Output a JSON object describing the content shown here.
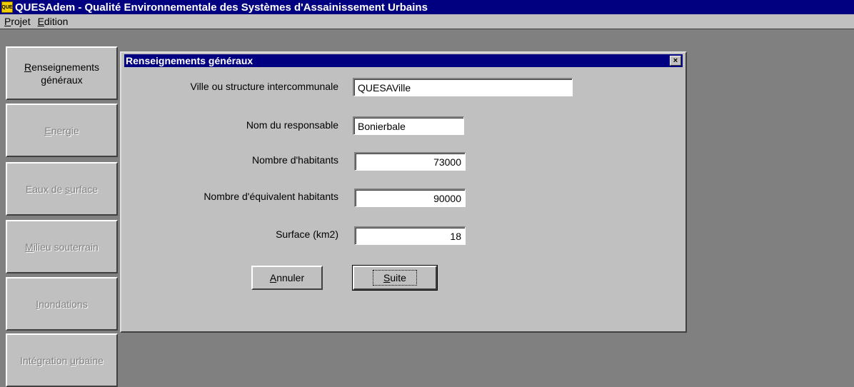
{
  "app": {
    "icon_text": "QUE",
    "title": "QUESAdem - Qualité Environnementale des Systèmes d'Assainissement Urbains"
  },
  "menu": [
    {
      "accel": "P",
      "rest": "rojet"
    },
    {
      "accel": "E",
      "rest": "dition"
    }
  ],
  "sidebar": {
    "items": [
      {
        "line1_accel": "R",
        "line1_rest": "enseignements",
        "line2": "généraux",
        "enabled": true
      },
      {
        "label_pre": "",
        "accel": "E",
        "label_post": "nergie",
        "enabled": false
      },
      {
        "label_pre": "Eaux de ",
        "accel": "s",
        "label_post": "urface",
        "enabled": false
      },
      {
        "label_pre": "",
        "accel": "M",
        "label_post": "ilieu souterrain",
        "enabled": false
      },
      {
        "label_pre": "",
        "accel": "I",
        "label_post": "nondations",
        "enabled": false
      },
      {
        "label_pre": "Intégration ",
        "accel": "u",
        "label_post": "rbaine",
        "enabled": false
      }
    ]
  },
  "dialog": {
    "title": "Renseignements généraux",
    "close_glyph": "×",
    "fields": [
      {
        "label": "Ville ou structure intercommunale",
        "value": "QUESAVille"
      },
      {
        "label": "Nom du responsable",
        "value": "Bonierbale"
      },
      {
        "label": "Nombre d'habitants",
        "value": "73000"
      },
      {
        "label": "Nombre d'équivalent habitants",
        "value": "90000"
      },
      {
        "label": "Surface (km2)",
        "value": "18"
      }
    ],
    "cancel_button": {
      "accel": "A",
      "rest": "nnuler"
    },
    "next_button": {
      "accel": "S",
      "rest": "uite"
    }
  },
  "colors": {
    "title_bar": "#000080",
    "face": "#c0c0c0",
    "workspace": "#808080",
    "disabled_text": "#808080"
  }
}
